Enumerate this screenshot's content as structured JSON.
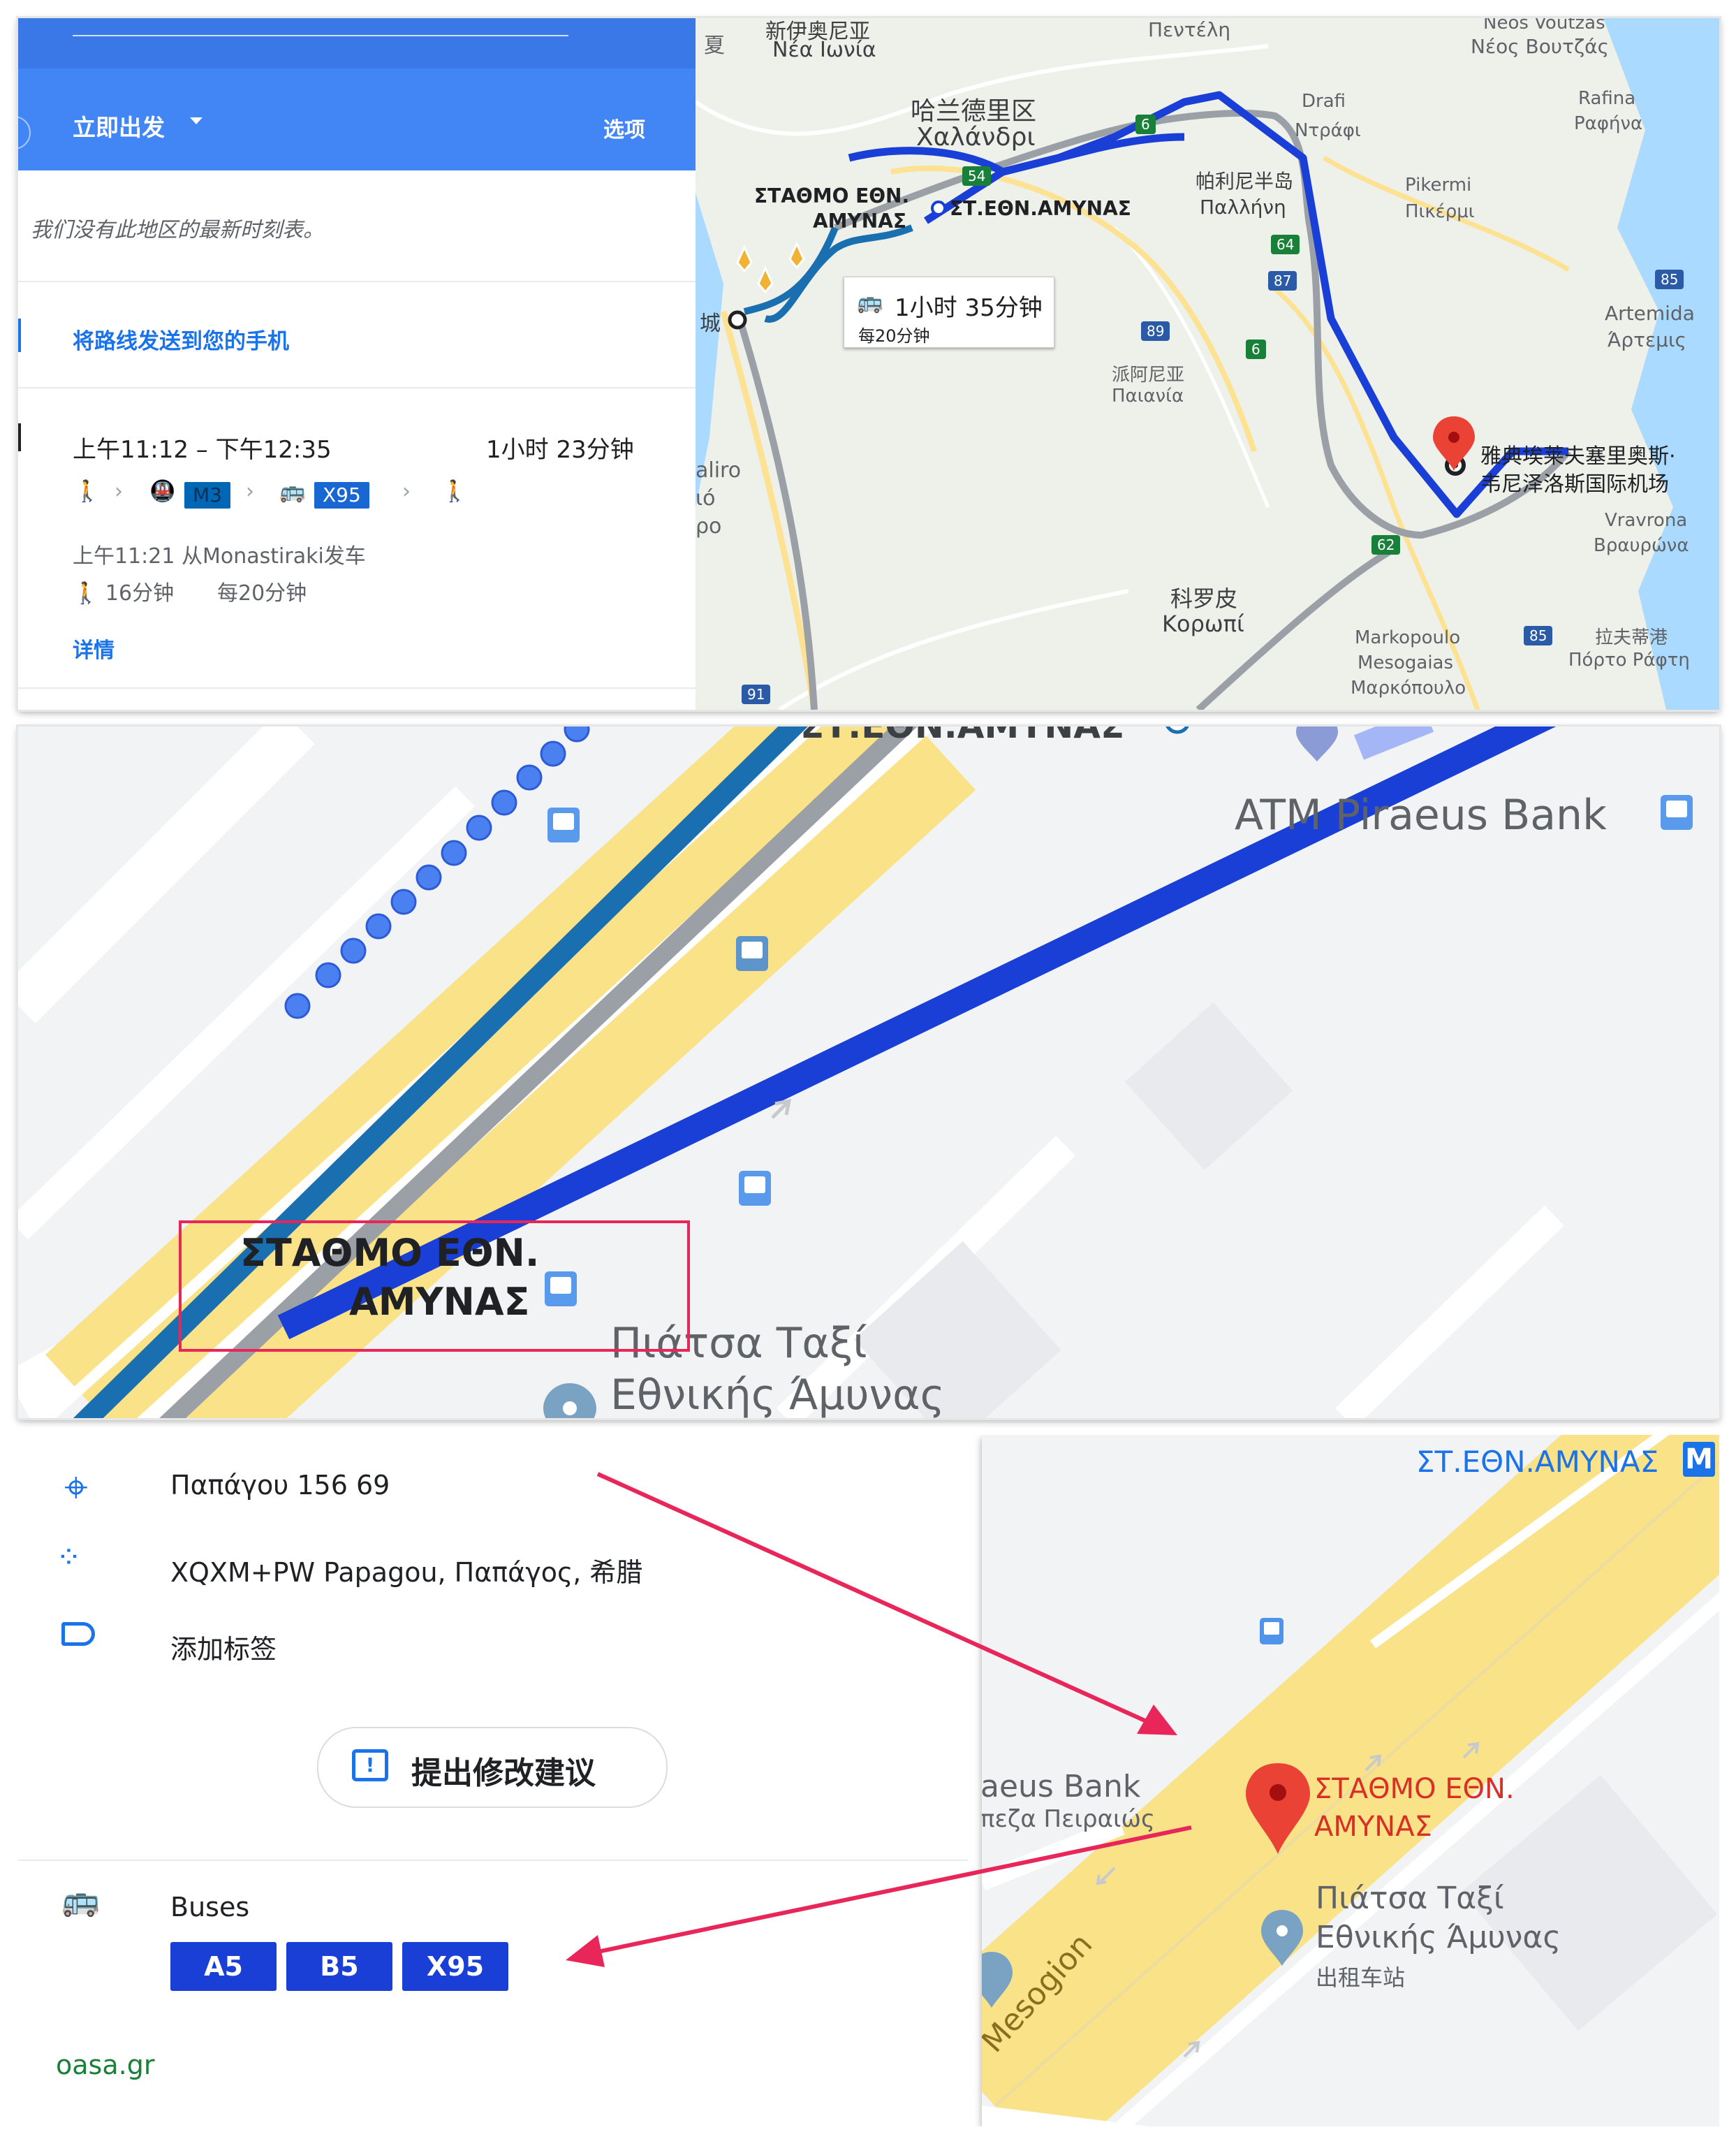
{
  "panel1": {
    "sidebar": {
      "depart_label": "立即出发",
      "options_label": "选项",
      "notice": "我们没有此地区的最新时刻表。",
      "send_to_phone": "将路线发送到您的手机",
      "route": {
        "time_range": "上午11:12 – 下午12:35",
        "duration": "1小时 23分钟",
        "metro_line": "M3",
        "bus_line": "X95",
        "departure": "上午11:21 从Monastiraki发车",
        "walk": "16分钟",
        "frequency": "每20分钟",
        "details_link": "详情"
      }
    },
    "map": {
      "callout_duration": "1小时 35分钟",
      "callout_frequency": "每20分钟",
      "labels": {
        "nea_ionia_cn": "新伊奥尼亚",
        "nea_ionia": "Νέα Ιωνία",
        "penteli": "Πεντέλη",
        "voutzas_en": "Neos Voutzas",
        "voutzas": "Νέος Βουτζάς",
        "chalandri_cn": "哈兰德里区",
        "chalandri": "Χαλάνδρι",
        "drafi_en": "Drafi",
        "drafi": "Ντράφι",
        "rafina_en": "Rafina",
        "rafina": "Ραφήνα",
        "station_big_1": "ΣΤΑΘΜΟ ΕΘΝ.",
        "station_big_2": "ΑΜΥΝΑΣ",
        "station_small": "ΣΤ.ΕΘΝ.ΑΜΥΝΑΣ",
        "pallini_cn": "帕利尼半岛",
        "pallini": "Παλλήνη",
        "pikermi_en": "Pikermi",
        "pikermi": "Πικέρμι",
        "artemida_en": "Artemida",
        "artemida": "Άρτεμις",
        "paiania_cn": "派阿尼亚",
        "paiania": "Παιανία",
        "airport_1": "雅典埃莱夫塞里奥斯·",
        "airport_2": "韦尼泽洛斯国际机场",
        "vravrona_en": "Vravrona",
        "vravrona": "Βραυρώνα",
        "koropi_cn": "科罗皮",
        "koropi": "Κορωπί",
        "markopoulo_1": "Markopoulo",
        "markopoulo_2": "Mesogaias",
        "markopoulo_3": "Μαρκόπουλο",
        "porto_rafti_cn": "拉夫蒂港",
        "porto_rafti": "Πόρτο Ράφτη",
        "city_fragment": "城",
        "xia_fragment": "夏",
        "faliro_1": "aliro",
        "faliro_2": "ιό",
        "faliro_3": "ρο"
      },
      "road_shields": [
        "6",
        "54",
        "64",
        "87",
        "89",
        "85",
        "6",
        "62",
        "85",
        "91"
      ]
    }
  },
  "panel2": {
    "station_1": "ΣΤΑΘΜΟ ΕΘΝ.",
    "station_2": "ΑΜΥΝΑΣ",
    "atm": "ATM Piraeus Bank",
    "taxi_1": "Πιάτσα Ταξί",
    "taxi_2": "Εθνικής Άμυνας",
    "top_cut": "ΣΤ.ΕΘΝ.ΑΜΥΝΑΣ"
  },
  "panel3": {
    "info": {
      "address": "Παπάγου 156 69",
      "plus_code": "XQXM+PW Papagou, Παπάγος, 希腊",
      "add_label": "添加标签",
      "suggest_edit": "提出修改建议",
      "buses_heading": "Buses",
      "bus_lines": [
        "A5",
        "B5",
        "X95"
      ],
      "source": "oasa.gr"
    },
    "map": {
      "station_top": "ΣΤ.ΕΘΝ.ΑΜΥΝΑΣ",
      "metro_glyph": "M",
      "station_1": "ΣΤΑΘΜΟ ΕΘΝ.",
      "station_2": "ΑΜΥΝΑΣ",
      "bank": "aeus Bank",
      "bank_gr": "πεζα Πειραιώς",
      "taxi_1": "Πιάτσα Ταξί",
      "taxi_2": "Εθνικής Άμυνας",
      "taxi_cn": "出租车站",
      "road": "Mesogion"
    }
  },
  "colors": {
    "route_blue": "#1a3fd6",
    "metro_blue": "#1a6fb0",
    "header_blue": "#4285f4",
    "highlight_red": "#e8265a",
    "pin_red": "#ea4335",
    "road_yellow": "#f9e287"
  }
}
